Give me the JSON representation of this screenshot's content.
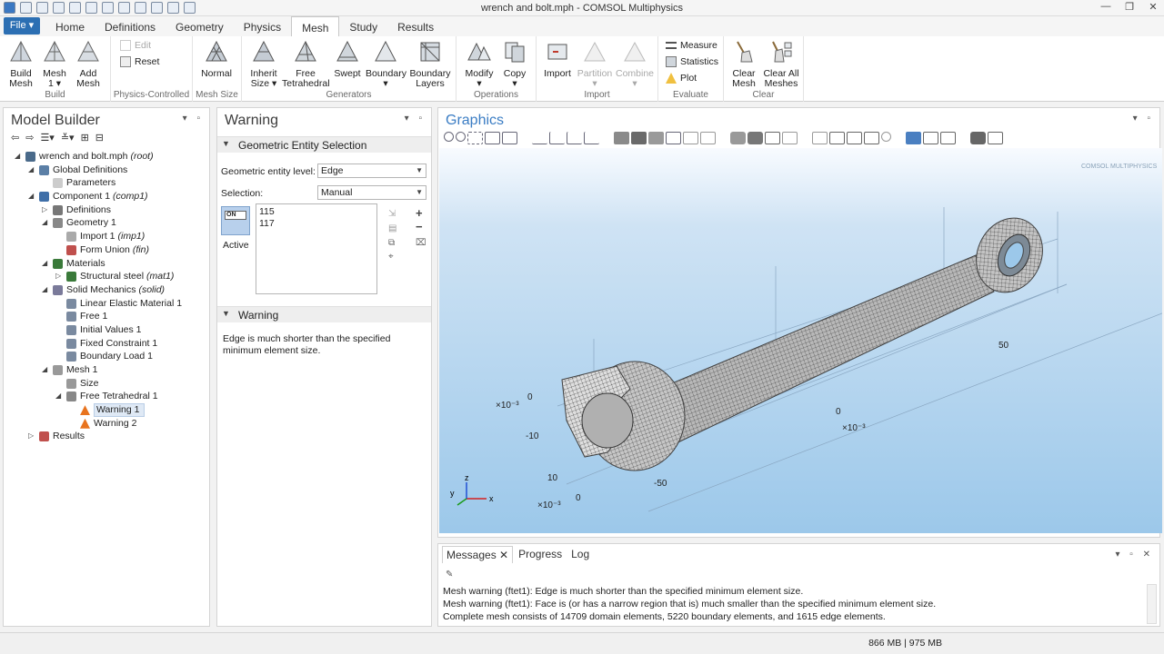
{
  "window": {
    "title": "wrench and bolt.mph - COMSOL Multiphysics"
  },
  "tabs": {
    "file": "File ▾",
    "items": [
      "Home",
      "Definitions",
      "Geometry",
      "Physics",
      "Mesh",
      "Study",
      "Results"
    ]
  },
  "ribbon": {
    "build": {
      "build_mesh": "Build\nMesh",
      "mesh1": "Mesh\n1 ▾",
      "add_mesh": "Add\nMesh",
      "label": "Build"
    },
    "physics": {
      "edit": "Edit",
      "reset": "Reset",
      "label": "Physics-Controlled"
    },
    "meshsize": {
      "normal": "Normal",
      "label": "Mesh Size"
    },
    "generators": {
      "inherit": "Inherit\nSize ▾",
      "free_tet": "Free\nTetrahedral",
      "swept": "Swept",
      "boundary": "Boundary\n▾",
      "boundary_layers": "Boundary\nLayers",
      "label": "Generators"
    },
    "operations": {
      "modify": "Modify\n▾",
      "copy": "Copy\n▾",
      "label": "Operations"
    },
    "import": {
      "import": "Import",
      "partition": "Partition\n▾",
      "combine": "Combine\n▾",
      "label": "Import"
    },
    "evaluate": {
      "measure": "Measure",
      "statistics": "Statistics",
      "plot": "Plot",
      "label": "Evaluate"
    },
    "clear": {
      "clear_mesh": "Clear\nMesh",
      "clear_all": "Clear All\nMeshes",
      "label": "Clear"
    }
  },
  "model_builder": {
    "title": "Model Builder",
    "tree": [
      {
        "label": "wrench and bolt.mph",
        "suffix": "(root)"
      },
      {
        "label": "Global Definitions",
        "suffix": ""
      },
      {
        "label": "Parameters",
        "suffix": ""
      },
      {
        "label": "Component 1",
        "suffix": "(comp1)"
      },
      {
        "label": "Definitions",
        "suffix": ""
      },
      {
        "label": "Geometry 1",
        "suffix": ""
      },
      {
        "label": "Import 1",
        "suffix": "(imp1)"
      },
      {
        "label": "Form Union",
        "suffix": "(fin)"
      },
      {
        "label": "Materials",
        "suffix": ""
      },
      {
        "label": "Structural steel",
        "suffix": "(mat1)"
      },
      {
        "label": "Solid Mechanics",
        "suffix": "(solid)"
      },
      {
        "label": "Linear Elastic Material 1",
        "suffix": ""
      },
      {
        "label": "Free 1",
        "suffix": ""
      },
      {
        "label": "Initial Values 1",
        "suffix": ""
      },
      {
        "label": "Fixed Constraint 1",
        "suffix": ""
      },
      {
        "label": "Boundary Load 1",
        "suffix": ""
      },
      {
        "label": "Mesh 1",
        "suffix": ""
      },
      {
        "label": "Size",
        "suffix": ""
      },
      {
        "label": "Free Tetrahedral 1",
        "suffix": ""
      },
      {
        "label": "Warning 1",
        "suffix": ""
      },
      {
        "label": "Warning 2",
        "suffix": ""
      },
      {
        "label": "Results",
        "suffix": ""
      }
    ]
  },
  "settings": {
    "title": "Warning",
    "section1": "Geometric Entity Selection",
    "entity_level_label": "Geometric entity level:",
    "entity_level_value": "Edge",
    "selection_label": "Selection:",
    "selection_value": "Manual",
    "toggle_text": "ON",
    "active_label": "Active",
    "selected": [
      "115",
      "117"
    ],
    "section2": "Warning",
    "warning_text": "Edge is much shorter than the specified minimum element size."
  },
  "graphics": {
    "title": "Graphics",
    "watermark": "COMSOL MULTIPHYSICS",
    "axis_labels": {
      "x_exp": "×10⁻³",
      "x0": "0",
      "xm10": "-10",
      "x10": "10",
      "y_exp": "×10⁻³",
      "y0": "0",
      "x50": "50",
      "xm50": "-50",
      "z_exp": "×10⁻³",
      "z0": "0",
      "z0b": "0"
    },
    "triad": {
      "x": "x",
      "y": "y",
      "z": "z"
    }
  },
  "messages": {
    "tabs": [
      "Messages ✕",
      "Progress",
      "Log"
    ],
    "lines": [
      "Mesh warning (ftet1): Edge is much shorter than the specified minimum element size.",
      "Mesh warning (ftet1): Face is (or has a narrow region that is) much smaller than the specified minimum element size.",
      "Complete mesh consists of 14709 domain elements, 5220 boundary elements, and 1615 edge elements."
    ]
  },
  "status": {
    "memory": "866 MB | 975 MB"
  },
  "colors": {
    "accent": "#2c6fb3",
    "viewport_top": "#f8fbff",
    "viewport_bottom": "#9cc8ea",
    "warning": "#e8731e"
  }
}
